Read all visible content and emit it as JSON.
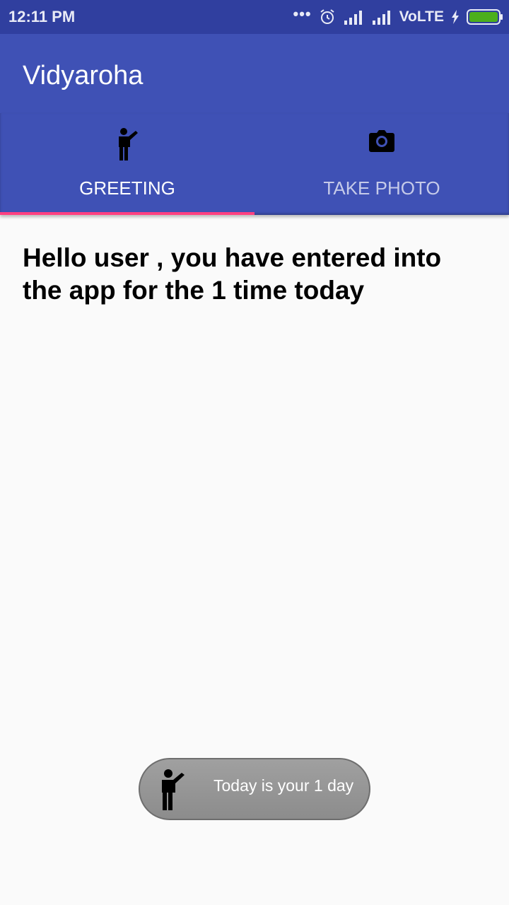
{
  "status_bar": {
    "time": "12:11 PM",
    "dots": "•••",
    "network": "VoLTE",
    "battery_color": "#4caf1c"
  },
  "app_bar": {
    "title": "Vidyaroha",
    "color": "#3f51b5"
  },
  "tabs": [
    {
      "label": "GREETING",
      "icon": "person-waving-icon",
      "selected": true
    },
    {
      "label": "TAKE PHOTO",
      "icon": "camera-icon",
      "selected": false
    }
  ],
  "tab_indicator_color": "#ff4081",
  "main": {
    "greeting": "Hello user , you have entered into the app for the 1 time today"
  },
  "toast": {
    "icon": "person-waving-icon",
    "text": "Today is your 1 day"
  }
}
